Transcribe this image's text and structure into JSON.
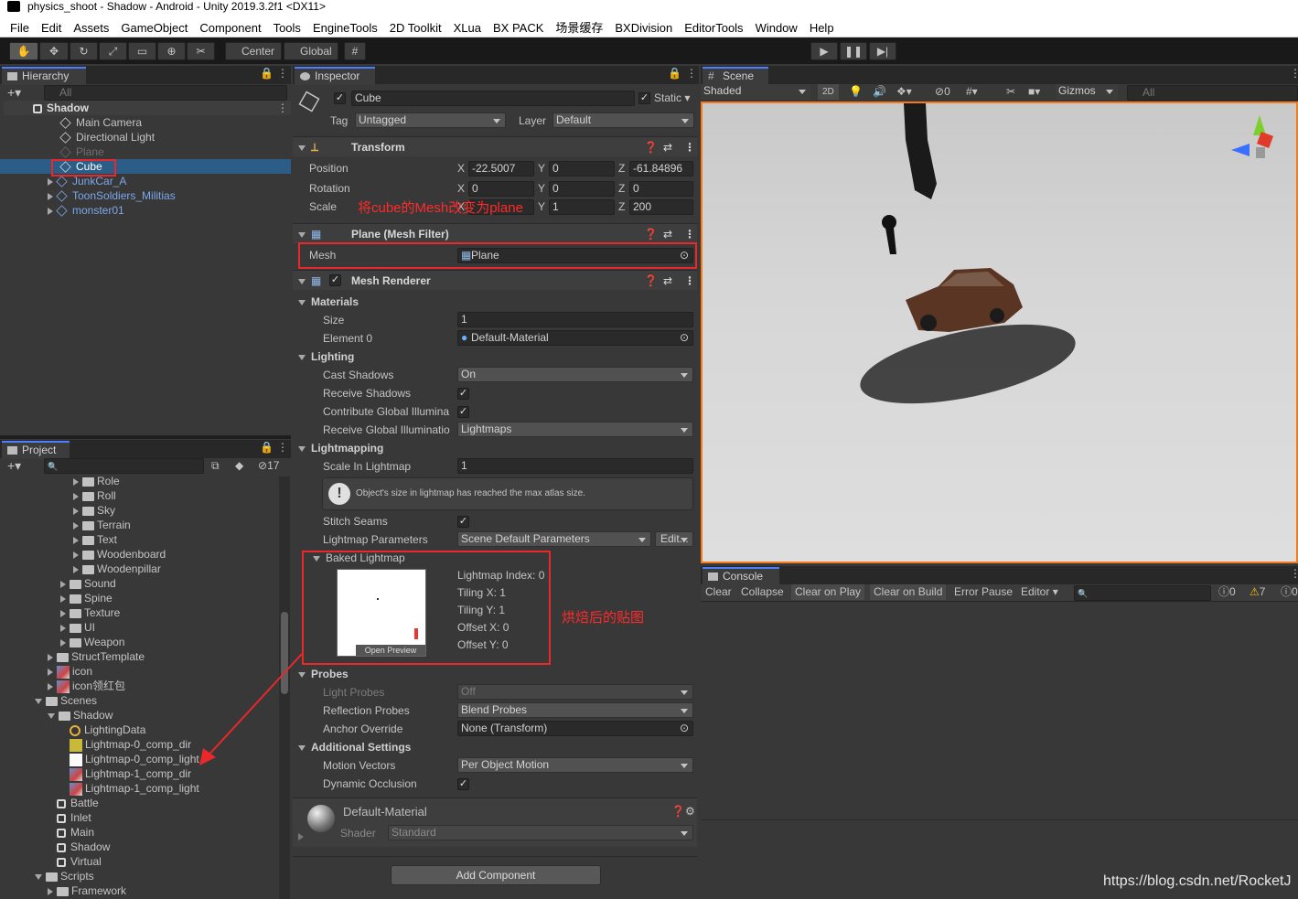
{
  "window": {
    "title": "physics_shoot - Shadow - Android - Unity 2019.3.2f1 <DX11>"
  },
  "menu": [
    "File",
    "Edit",
    "Assets",
    "GameObject",
    "Component",
    "Tools",
    "EngineTools",
    "2D Toolkit",
    "XLua",
    "BX PACK",
    "场景缓存",
    "BXDivision",
    "EditorTools",
    "Window",
    "Help"
  ],
  "toolbar": {
    "center": "Center",
    "global": "Global"
  },
  "hierarchy": {
    "tab": "Hierarchy",
    "search_placeholder": "All",
    "scene": "Shadow",
    "items": [
      {
        "label": "Main Camera"
      },
      {
        "label": "Directional Light"
      },
      {
        "label": "Plane"
      },
      {
        "label": "Cube"
      },
      {
        "label": "JunkCar_A"
      },
      {
        "label": "ToonSoldiers_Militias"
      },
      {
        "label": "monster01"
      }
    ]
  },
  "project": {
    "tab": "Project",
    "hidden_count": "17",
    "items": [
      "Role",
      "Roll",
      "Sky",
      "Terrain",
      "Text",
      "Woodenboard",
      "Woodenpillar",
      "Sound",
      "Spine",
      "Texture",
      "UI",
      "Weapon",
      "StructTemplate",
      "icon",
      "icon领红包",
      "Scenes",
      "Shadow",
      "LightingData",
      "Lightmap-0_comp_dir",
      "Lightmap-0_comp_light",
      "Lightmap-1_comp_dir",
      "Lightmap-1_comp_light",
      "Battle",
      "Inlet",
      "Main",
      "Shadow",
      "Virtual",
      "Scripts",
      "Framework"
    ]
  },
  "inspector": {
    "tab": "Inspector",
    "object_name": "Cube",
    "static_label": "Static",
    "tag_label": "Tag",
    "tag_value": "Untagged",
    "layer_label": "Layer",
    "layer_value": "Default",
    "transform": {
      "title": "Transform",
      "position_label": "Position",
      "rotation_label": "Rotation",
      "scale_label": "Scale",
      "px": "-22.5007",
      "py": "0",
      "pz": "-61.84896",
      "rx": "0",
      "ry": "0",
      "rz": "0",
      "sx": "",
      "sy": "1",
      "sz": "200",
      "axis_x": "X",
      "axis_y": "Y",
      "axis_z": "Z"
    },
    "mesh_filter": {
      "title": "Plane (Mesh Filter)",
      "mesh_label": "Mesh",
      "mesh_value": "Plane"
    },
    "mesh_renderer": {
      "title": "Mesh Renderer",
      "materials": "Materials",
      "size_label": "Size",
      "size_value": "1",
      "element0_label": "Element 0",
      "element0_value": "Default-Material",
      "lighting": "Lighting",
      "cast_shadows_label": "Cast Shadows",
      "cast_shadows_value": "On",
      "receive_shadows": "Receive Shadows",
      "contribute_gi": "Contribute Global Illumina",
      "receive_gi_label": "Receive Global Illuminatio",
      "receive_gi_value": "Lightmaps",
      "lightmapping": "Lightmapping",
      "scale_lightmap_label": "Scale In Lightmap",
      "scale_lightmap_value": "1",
      "atlas_message": "Object's size in lightmap has reached the max atlas size.",
      "stitch_seams": "Stitch Seams",
      "lightmap_params_label": "Lightmap Parameters",
      "lightmap_params_value": "Scene Default Parameters",
      "edit_button": "Edit...",
      "baked_lightmap": "Baked Lightmap",
      "open_preview": "Open Preview",
      "lightmap_index": "Lightmap Index: 0",
      "tiling_x": "Tiling X: 1",
      "tiling_y": "Tiling Y: 1",
      "offset_x": "Offset X: 0",
      "offset_y": "Offset Y: 0",
      "probes": "Probes",
      "light_probes_label": "Light Probes",
      "light_probes_value": "Off",
      "reflection_probes_label": "Reflection Probes",
      "reflection_probes_value": "Blend Probes",
      "anchor_override_label": "Anchor Override",
      "anchor_override_value": "None (Transform)",
      "additional_settings": "Additional Settings",
      "motion_vectors_label": "Motion Vectors",
      "motion_vectors_value": "Per Object Motion",
      "dynamic_occlusion": "Dynamic Occlusion"
    },
    "material": {
      "name": "Default-Material",
      "shader_label": "Shader",
      "shader_value": "Standard"
    },
    "add_component": "Add Component"
  },
  "annotations": {
    "mesh_note": "将cube的Mesh改变为plane",
    "baked_note": "烘焙后的贴图"
  },
  "scene": {
    "tab": "Scene",
    "shading": "Shaded",
    "mode_2d": "2D",
    "hidden_count": "0",
    "gizmos": "Gizmos",
    "search_placeholder": "All"
  },
  "console": {
    "tab": "Console",
    "clear": "Clear",
    "collapse": "Collapse",
    "clear_on_play": "Clear on Play",
    "clear_on_build": "Clear on Build",
    "error_pause": "Error Pause",
    "editor": "Editor",
    "info_count": "0",
    "warn_count": "7",
    "error_count": "0"
  },
  "watermark": "https://blog.csdn.net/RocketJ",
  "colors": {
    "accent": "#4c7fff",
    "selection": "#2c5d87",
    "annotation": "#e8282b",
    "scene_highlight": "#f47a1e"
  }
}
